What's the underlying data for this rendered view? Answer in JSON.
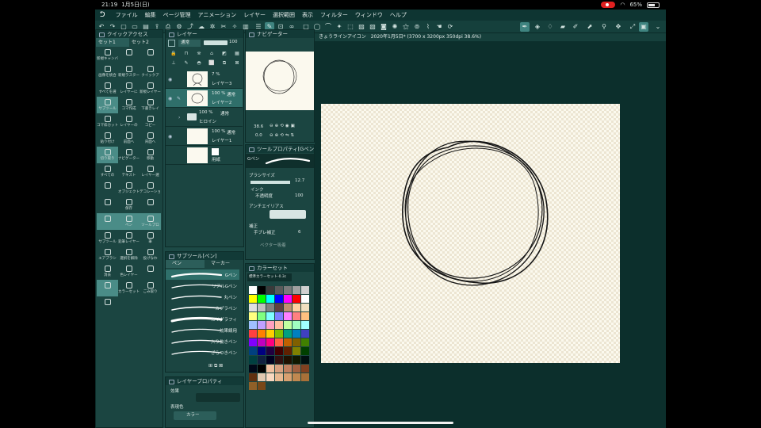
{
  "status": {
    "time": "21:19",
    "date": "1月5日(日)",
    "battery": "65%"
  },
  "menu": [
    "ファイル",
    "編集",
    "ページ管理",
    "アニメーション",
    "レイヤー",
    "選択範囲",
    "表示",
    "フィルター",
    "ウィンドウ",
    "ヘルプ"
  ],
  "quick": {
    "title": "クイックアクセス",
    "tabs": [
      "セット1",
      "セット2"
    ],
    "items": [
      "新規キャンバス",
      "",
      "",
      "画像を統合",
      "新規ラスター",
      "クイックア",
      "すべてを選",
      "レイヤーに",
      "新規レイヤー",
      "サブツール",
      "コマ作成",
      "下書きレイ",
      "コマ枠カット",
      "レイヤーの",
      "コピー",
      "貼り付け",
      "前面へ",
      "背面へ",
      "切り取り",
      "ナビゲーター",
      "移動",
      "すべての",
      "テキスト",
      "レイヤー選",
      "",
      "オブジェクト",
      "デコレーション",
      "",
      "保存",
      "",
      "",
      "ペン",
      "ツールプロ",
      "サブツール",
      "鉛筆レイヤー",
      "筆",
      "エアブラシ",
      "選択を解除",
      "投げなわ",
      "消去",
      "色レイヤー",
      "",
      "",
      "カラーセット",
      "ごみ取り",
      ""
    ]
  },
  "layer": {
    "title": "レイヤー",
    "blend": "通常",
    "opacity": "100",
    "rows": [
      {
        "pct": "7 %",
        "mode": "",
        "name": "レイヤー3"
      },
      {
        "pct": "100 %",
        "mode": "通常",
        "name": "レイヤー2"
      },
      {
        "pct": "100 %",
        "mode": "通常",
        "name": "ヒロイン"
      },
      {
        "pct": "100 %",
        "mode": "通常",
        "name": "レイヤー1"
      },
      {
        "pct": "",
        "mode": "",
        "name": "用紙"
      }
    ]
  },
  "subtool": {
    "title": "サブツール[ペン]",
    "tabs": [
      "ペン",
      "マーカー"
    ],
    "brushes": [
      "Gペン",
      "リアルGペン",
      "丸ペン",
      "カブラペン",
      "カリグラフィ",
      "効果線用",
      "入り抜きペン",
      "ざらつきペン"
    ]
  },
  "layerprop": {
    "title": "レイヤープロパティ",
    "effect": "効果",
    "expr": "表現色",
    "color": "カラー"
  },
  "navigator": {
    "title": "ナビゲーター",
    "zoom": "38.6",
    "rotate": "0.0"
  },
  "toolprop": {
    "title": "ツールプロパティ[Gペン]",
    "brush": "Gペン",
    "size_label": "ブラシサイズ",
    "size": "12.7",
    "ink": "インク",
    "opacity_label": "不透明度",
    "opacity": "100",
    "aa": "アンチエイリアス",
    "corr": "補正",
    "stab_label": "手ブレ補正",
    "stab": "6",
    "vector": "ベクター吸着"
  },
  "colorset": {
    "title": "カラーセット",
    "set": "標準カラーセット-0.3c",
    "colors": [
      "#ffffff",
      "#000000",
      "#3a3a3a",
      "#5a5a5a",
      "#7a7a7a",
      "#a0a0a0",
      "#d0d0d0",
      "#ffff00",
      "#00ff00",
      "#00ffff",
      "#0000ff",
      "#ff00ff",
      "#ff0000",
      "#ffffff",
      "#e0e0e0",
      "#c0c0c0",
      "#808080",
      "#604040",
      "#c09070",
      "#ffd0a0",
      "#f0e0c0",
      "#ffff80",
      "#80ff80",
      "#80ffff",
      "#8080ff",
      "#ff80ff",
      "#ff8080",
      "#ffc080",
      "#a0c0ff",
      "#c0a0ff",
      "#ffa0c0",
      "#ffc0a0",
      "#c0ffa0",
      "#a0ffc0",
      "#a0ffff",
      "#ff4040",
      "#ff8000",
      "#ffd000",
      "#80c000",
      "#00a080",
      "#0080c0",
      "#4040c0",
      "#8000ff",
      "#c000c0",
      "#ff0080",
      "#ff6040",
      "#c06000",
      "#806000",
      "#408000",
      "#004080",
      "#000080",
      "#200040",
      "#400000",
      "#602000",
      "#808000",
      "#004000",
      "#004040",
      "#102040",
      "#000020",
      "#301010",
      "#201000",
      "#101800",
      "#001010",
      "#000818",
      "#000000",
      "#f0c0a0",
      "#d8a080",
      "#c08060",
      "#a06040",
      "#804020",
      "#603010",
      "#e0c8b0",
      "#f8d8c0",
      "#e8b890",
      "#d8a070",
      "#c08850",
      "#a87038",
      "#906028",
      "#784818"
    ]
  },
  "doc": {
    "tab": "きょうラインアイコン　2020年1月5日* (3700 x 3200px 350dpi 38.6%)"
  }
}
